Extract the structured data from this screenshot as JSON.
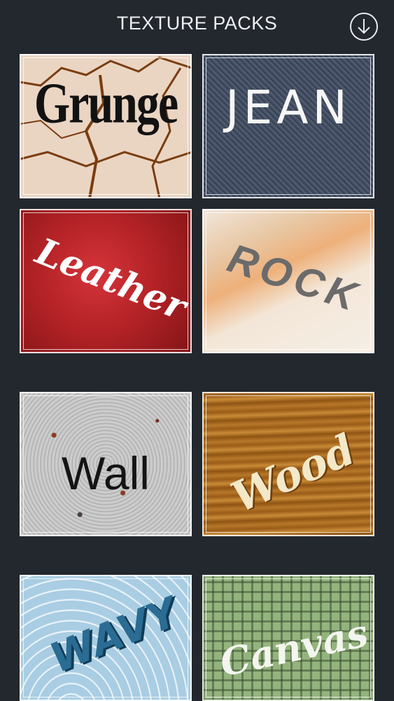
{
  "header": {
    "title": "TEXTURE PACKS",
    "download_icon": "download-arrow-circle-icon"
  },
  "packs": [
    {
      "label": "Grunge"
    },
    {
      "label": "JEAN"
    },
    {
      "label": "Leather"
    },
    {
      "label": "ROCK"
    },
    {
      "label": "Wall"
    },
    {
      "label": "Wood"
    },
    {
      "label": "WAVY"
    },
    {
      "label": "Canvas"
    }
  ],
  "colors": {
    "background": "#23272e",
    "title_text": "#eef0f3"
  }
}
